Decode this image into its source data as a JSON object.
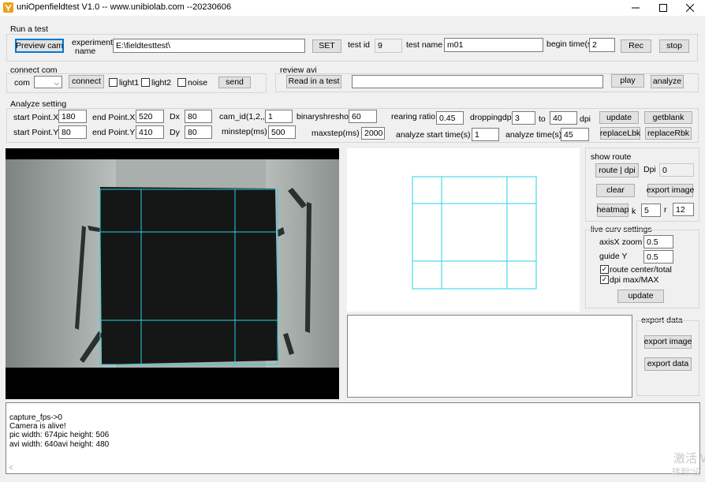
{
  "window": {
    "title": "uniOpenfieldtest V1.0  -- www.unibiolab.com --20230606",
    "minimize_icon": "minimize-icon",
    "maximize_icon": "maximize-icon",
    "close_icon": "close-icon"
  },
  "run_test": {
    "group_label": "Run a test",
    "preview_button": "Preview cam",
    "experiment_label_1": "experiment",
    "experiment_label_2": "name",
    "experiment_value": "E:\\fieldtesttest\\",
    "set_button": "SET",
    "test_id_label": "test id",
    "test_id_value": "9",
    "test_name_label": "test name",
    "test_name_value": "m01",
    "begin_time_label": "begin time(s)",
    "begin_time_value": "2",
    "rec_button": "Rec",
    "stop_button": "stop"
  },
  "connect_com": {
    "group_label": "connect com",
    "com_label": "com",
    "com_value": "",
    "connect_button": "connect",
    "light1_label": "light1",
    "light2_label": "light2",
    "noise_label": "noise",
    "send_button": "send"
  },
  "review_avi": {
    "group_label": "review avi",
    "read_button": "Read in a test",
    "path_value": "",
    "play_button": "play",
    "analyze_button": "analyze"
  },
  "analyze_setting": {
    "group_label": "Analyze setting",
    "start_x_label": "start Point.X",
    "start_x_value": "180",
    "end_x_label": "end Point.X",
    "end_x_value": "520",
    "dx_label": "Dx",
    "dx_value": "80",
    "cam_id_label": "cam_id(1,2,,)",
    "cam_id_value": "1",
    "binary_label": "binaryshreshod",
    "binary_value": "60",
    "rearing_label": "rearing ratio",
    "rearing_value": "0.45",
    "dropping_label": "droppingdpi",
    "dropping_from": "3",
    "to_label": "to",
    "dropping_to": "40",
    "dpi_label": "dpi",
    "update_button": "update",
    "getblank_button": "getblank",
    "start_y_label": "start Point.Y",
    "start_y_value": "80",
    "end_y_label": "end Point.Y",
    "end_y_value": "410",
    "dy_label": "Dy",
    "dy_value": "80",
    "minstep_label": "minstep(ms)",
    "minstep_value": "500",
    "maxstep_label": "maxstep(ms)",
    "maxstep_value": "2000",
    "analyze_start_label": "analyze start time(s)",
    "analyze_start_value": "1",
    "analyze_time_label": "analyze time(s)",
    "analyze_time_value": "45",
    "replace_lbk_button": "replaceLbk",
    "replace_rbk_button": "replaceRbk"
  },
  "show_route": {
    "group_label": "show route",
    "route_dpi_button": "route | dpi",
    "dpi_label": "Dpi",
    "dpi_value": "0",
    "clear_button": "clear",
    "export_image_button": "export image",
    "heatmap_button": "heatmap",
    "k_label": "k",
    "k_value": "5",
    "r_label": "r",
    "r_value": "12"
  },
  "live_curv": {
    "group_label": "live curv settings",
    "axis_zoom_label": "axisX zoom",
    "axis_zoom_value": "0.5",
    "guide_y_label": "guide Y",
    "guide_y_value": "0.5",
    "route_center_label": "route center/total",
    "route_center_checked": true,
    "dpi_max_label": "dpi max/MAX",
    "dpi_max_checked": true,
    "update_button": "update"
  },
  "export_data": {
    "group_label": "export data",
    "export_image_button": "export image",
    "export_data_button": "export data"
  },
  "log": {
    "lines": [
      "capture_fps->0",
      "Camera is alive!",
      "pic width: 674pic height: 506",
      "avi width: 640avi height: 480"
    ]
  },
  "watermark": {
    "line1": "激活 W",
    "line2": "转到\"设"
  },
  "colors": {
    "grid_line": "#27d3e6",
    "window_bg": "#f0f0f0",
    "primary_border": "#0078d7"
  }
}
